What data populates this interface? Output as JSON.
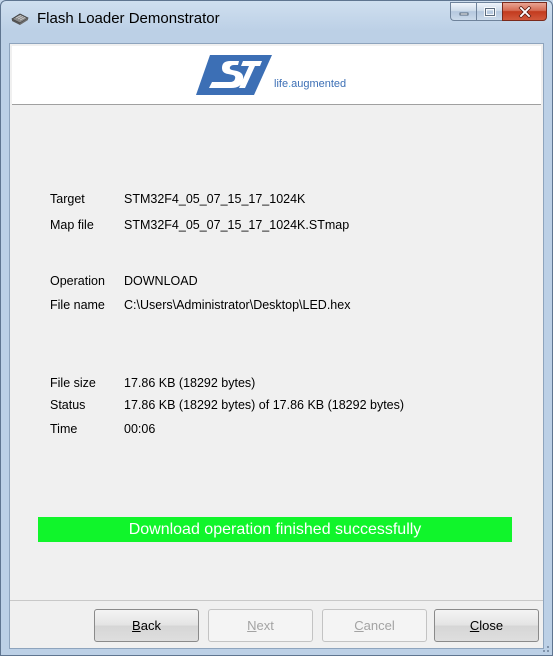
{
  "window": {
    "title": "Flash Loader Demonstrator",
    "minimize_icon": "minimize-icon",
    "maximize_icon": "maximize-icon",
    "close_icon": "close-icon"
  },
  "banner": {
    "logo": "ST",
    "tagline_prefix": "life",
    "tagline_dot": ".",
    "tagline_suffix": "augmented"
  },
  "info": {
    "target_label": "Target",
    "target_value": "STM32F4_05_07_15_17_1024K",
    "mapfile_label": "Map file",
    "mapfile_value": "STM32F4_05_07_15_17_1024K.STmap",
    "operation_label": "Operation",
    "operation_value": "DOWNLOAD",
    "filename_label": "File name",
    "filename_value": "C:\\Users\\Administrator\\Desktop\\LED.hex",
    "filesize_label": "File size",
    "filesize_value": "17.86 KB (18292 bytes)",
    "status_label": "Status",
    "status_value": "17.86 KB (18292 bytes) of 17.86 KB (18292 bytes)",
    "time_label": "Time",
    "time_value": "00:06"
  },
  "progress": {
    "message": "Download operation finished successfully",
    "fraction": 1.0,
    "color": "#10f52b"
  },
  "buttons": {
    "back": "Back",
    "next": "Next",
    "cancel": "Cancel",
    "close": "Close"
  },
  "colors": {
    "st_blue": "#3c6fb5",
    "tagline_dot": "#3cb4e6"
  }
}
